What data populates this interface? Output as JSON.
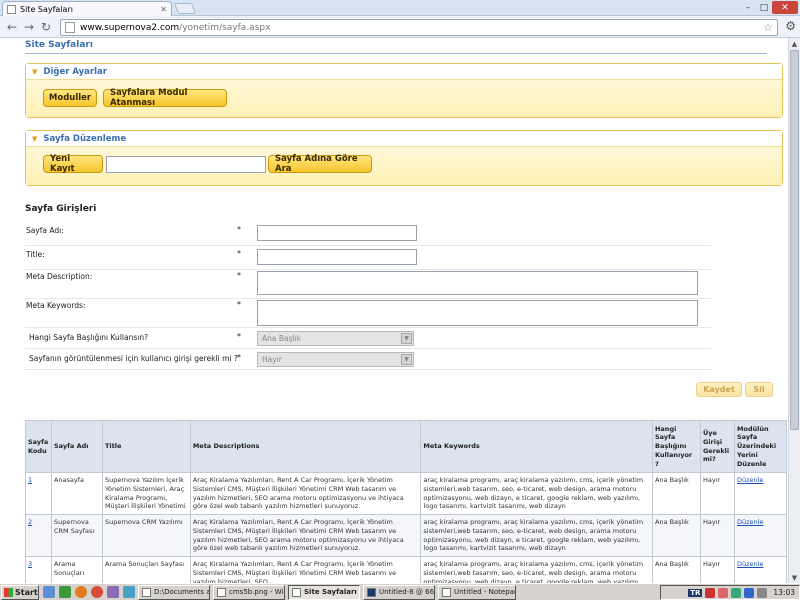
{
  "browser": {
    "tab_title": "Site Sayfaları",
    "url_host": "www.supernova2.com",
    "url_path": "/yonetim/sayfa.aspx"
  },
  "page": {
    "title": "Site Sayfaları",
    "diger_ayarlar": {
      "header": "Diğer Ayarlar",
      "moduller_label": "Moduller",
      "modul_atama_label": "Sayfalara Modul Atanması"
    },
    "sayfa_duzenleme": {
      "header": "Sayfa Düzenleme",
      "yeni_kayit_label": "Yeni Kayıt",
      "search_value": "",
      "search_label": "Sayfa Adına Göre Ara"
    },
    "form": {
      "title": "Sayfa Girişleri",
      "required_mark": "*",
      "fields": [
        {
          "label": "Sayfa Adı:",
          "value": ""
        },
        {
          "label": "Title:",
          "value": ""
        },
        {
          "label": "Meta Description:",
          "value": ""
        },
        {
          "label": "Meta Keywords:",
          "value": ""
        },
        {
          "label": "Hangi Sayfa Başlığını Kullansın?",
          "value": "Ana Başlık"
        },
        {
          "label": "Sayfanın görüntülenmesi için kullanıcı girişi gerekli mi ?",
          "value": "Hayır"
        }
      ],
      "kaydet_label": "Kaydet",
      "sil_label": "Sil"
    },
    "table": {
      "headers": [
        "Sayfa Kodu",
        "Sayfa Adı",
        "Title",
        "Meta Descriptions",
        "Meta Keywords",
        "Hangi Sayfa Başlığını Kullanıyor ?",
        "Üye Girişi Gerekli mi?",
        "Modülün Sayfa Üzerindeki Yerini Düzenle"
      ],
      "rows": [
        {
          "kod": "1",
          "ad": "Anasayfa",
          "title": "Supernova Yazılım İçerik Yönetim Sistemleri, Araç Kiralama Programı, Müşteri İlişkileri Yönetimi",
          "desc": "Araç Kiralama Yazılımları, Rent A Car Programı, İçerik Yönetim Sistemleri CMS, Müşteri İlişkileri Yönetimi CRM Web tasarım ve yazılım hizmetleri, SEO arama motoru optimizasyonu ve ihtiyaca göre özel web tabanlı yazılım hizmetleri sunuyoruz.",
          "keywords": "araç kiralama programı, araç kiralama yazılımı, cms, içerik yönetim sistemleri,web tasarım, seo, e-ticaret, web design, arama motoru optimizasyonu, web dizayn, e ticaret, google reklam, web yazılımı, logo tasarımı, kartvizit tasarımı, web dizayn",
          "baslik": "Ana Başlık",
          "uye": "Hayır",
          "duzenle": "Düzenle"
        },
        {
          "kod": "2",
          "ad": "Supernova CRM Sayfası",
          "title": "Supernova CRM Yazılımı",
          "desc": "Araç Kiralama Yazılımları, Rent A Car Programı, İçerik Yönetim Sistemleri CMS, Müşteri İlişkileri Yönetimi CRM Web tasarım ve yazılım hizmetleri, SEO arama motoru optimizasyonu ve ihtiyaca göre özel web tabanlı yazılım hizmetleri sunuyoruz.",
          "keywords": "araç kiralama programı, araç kiralama yazılımı, cms, içerik yönetim sistemleri,web tasarım, seo, e-ticaret, web design, arama motoru optimizasyonu, web dizayn, e ticaret, google reklam, web yazılımı, logo tasarımı, kartvizit tasarımı, web dizayn",
          "baslik": "Ana Başlık",
          "uye": "Hayır",
          "duzenle": "Düzenle"
        },
        {
          "kod": "3",
          "ad": "Arama Sonuçları",
          "title": "Arama Sonuçları Sayfası",
          "desc": "Araç Kiralama Yazılımları, Rent A Car Programı, İçerik Yönetim Sistemleri CMS, Müşteri İlişkileri Yönetimi CRM Web tasarım ve yazılım hizmetleri, SEO",
          "keywords": "araç kiralama programı, araç kiralama yazılımı, cms, içerik yönetim sistemleri,web tasarım, seo, e-ticaret, web design, arama motoru optimizasyonu, web dizayn, e ticaret, google reklam, web yazılımı, logo",
          "baslik": "Ana Başlık",
          "uye": "Hayır",
          "duzenle": "Düzenle"
        }
      ]
    }
  },
  "taskbar": {
    "start_label": "Start",
    "windows": [
      "D:\\Documents a...",
      "cms5b.png - Win...",
      "Site Sayfaları - ...",
      "Untitled-8 @ 66,...",
      "Untitled - Notepad"
    ],
    "tray_lang": "TR",
    "clock": "13:03"
  }
}
